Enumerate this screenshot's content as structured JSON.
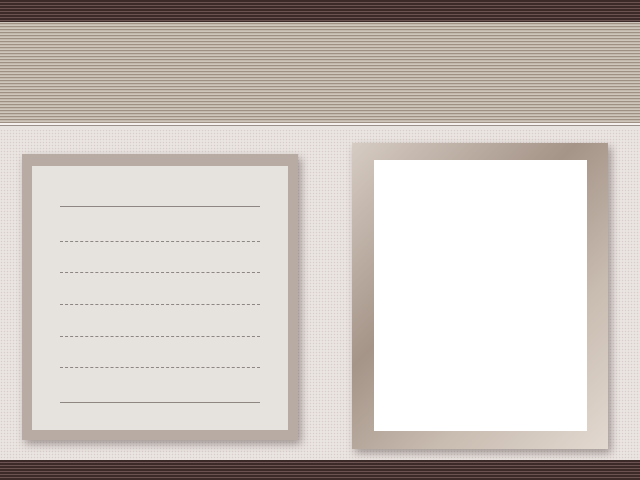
{
  "theme": {
    "bar_color": "#3b2a28",
    "header_color": "#b3a79a",
    "background_color": "#ebe5e2",
    "panel_color": "#b8aba3",
    "paper_color": "#e6e2de",
    "photo_color": "#ffffff"
  },
  "notepad": {
    "lines": [
      "",
      "",
      "",
      "",
      "",
      "",
      ""
    ]
  },
  "photo_frame": {
    "content": ""
  }
}
